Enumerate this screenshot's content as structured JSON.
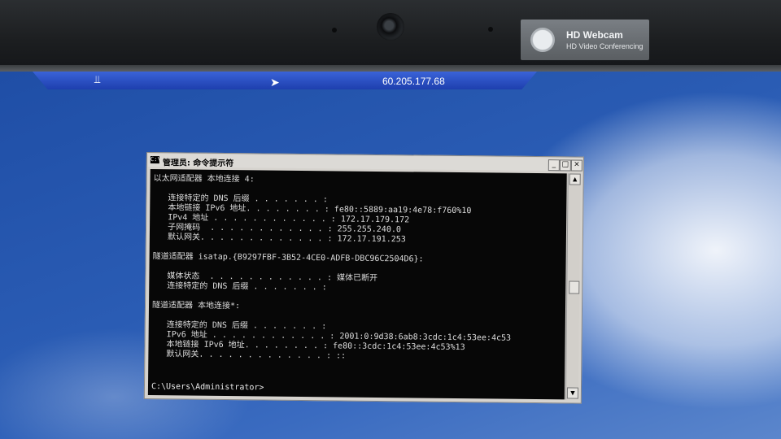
{
  "webcam_badge": {
    "title": "HD Webcam",
    "subtitle": "HD Video Conferencing"
  },
  "rdp_bar": {
    "host": "60.205.177.68"
  },
  "cmd_window": {
    "title": "管理员: 命令提示符",
    "controls": {
      "minimize": "_",
      "maximize": "□",
      "close": "×"
    },
    "lines": [
      "以太网适配器 本地连接 4:",
      "",
      "   连接特定的 DNS 后缀 . . . . . . . :",
      "   本地链接 IPv6 地址. . . . . . . . : fe80::5889:aa19:4e78:f760%10",
      "   IPv4 地址 . . . . . . . . . . . . : 172.17.179.172",
      "   子网掩码  . . . . . . . . . . . . : 255.255.240.0",
      "   默认网关. . . . . . . . . . . . . : 172.17.191.253",
      "",
      "隧道适配器 isatap.{B9297FBF-3B52-4CE0-ADFB-DBC96C2504D6}:",
      "",
      "   媒体状态  . . . . . . . . . . . . : 媒体已断开",
      "   连接特定的 DNS 后缀 . . . . . . . :",
      "",
      "隧道适配器 本地连接*:",
      "",
      "   连接特定的 DNS 后缀 . . . . . . . :",
      "   IPv6 地址 . . . . . . . . . . . . : 2001:0:9d38:6ab8:3cdc:1c4:53ee:4c53",
      "   本地链接 IPv6 地址. . . . . . . . : fe80::3cdc:1c4:53ee:4c53%13",
      "   默认网关. . . . . . . . . . . . . : ::",
      "",
      "C:\\Users\\Administrator>"
    ]
  }
}
